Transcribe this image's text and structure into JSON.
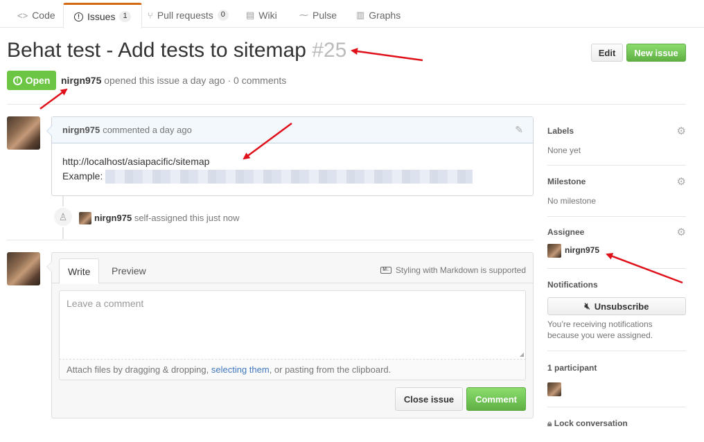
{
  "tabs": [
    {
      "icon": "<>",
      "label": "Code"
    },
    {
      "icon": "!",
      "label": "Issues",
      "count": "1"
    },
    {
      "icon": "⑂",
      "label": "Pull requests",
      "count": "0"
    },
    {
      "icon": "▤",
      "label": "Wiki"
    },
    {
      "icon": "⁓",
      "label": "Pulse"
    },
    {
      "icon": "▥",
      "label": "Graphs"
    }
  ],
  "issue": {
    "title": "Behat test - Add tests to sitemap",
    "number": "#25",
    "state": "Open",
    "author": "nirgn975",
    "meta_text": "opened this issue a day ago · 0 comments"
  },
  "actions": {
    "edit_label": "Edit",
    "new_issue_label": "New issue"
  },
  "comment": {
    "author": "nirgn975",
    "time_text": "commented a day ago",
    "line1": "http://localhost/asiapacific/sitemap",
    "line2_label": "Example:"
  },
  "event": {
    "actor": "nirgn975",
    "text": "self-assigned this just now"
  },
  "form": {
    "write_tab": "Write",
    "preview_tab": "Preview",
    "markdown_note": "Styling with Markdown is supported",
    "placeholder": "Leave a comment",
    "attach_prefix": "Attach files by dragging & dropping, ",
    "attach_link": "selecting them",
    "attach_suffix": ", or pasting from the clipboard.",
    "close_label": "Close issue",
    "comment_label": "Comment"
  },
  "sidebar": {
    "labels_heading": "Labels",
    "labels_value": "None yet",
    "milestone_heading": "Milestone",
    "milestone_value": "No milestone",
    "assignee_heading": "Assignee",
    "assignee_name": "nirgn975",
    "notifications_heading": "Notifications",
    "unsubscribe_label": "Unsubscribe",
    "notifications_text": "You’re receiving notifications because you were assigned.",
    "participants_heading": "1 participant",
    "lock_label": "Lock conversation"
  },
  "colors": {
    "accent_tab": "#d26911",
    "open_green": "#6cc644",
    "annotation_red": "#e0101a",
    "link_blue": "#4078c0"
  }
}
